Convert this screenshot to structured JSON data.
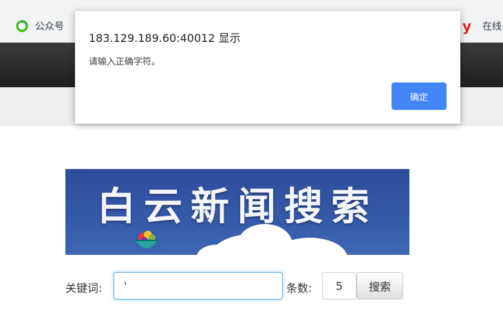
{
  "browser": {
    "bookmarks": [
      {
        "label": "公众号",
        "icon": "wechat-icon"
      },
      {
        "label": "在线",
        "icon": "y-logo-icon"
      }
    ]
  },
  "banner": {
    "title": "白云新闻搜索"
  },
  "search": {
    "keyword_label": "关键词:",
    "keyword_value": "'",
    "count_label": "条数:",
    "count_value": "5",
    "button_label": "搜索"
  },
  "alert": {
    "title": "183.129.189.60:40012 显示",
    "message": "请输入正确字符。",
    "ok_label": "确定"
  },
  "colors": {
    "accent": "#4285f4",
    "header": "#2a2a2a",
    "banner": "#3558a8"
  }
}
